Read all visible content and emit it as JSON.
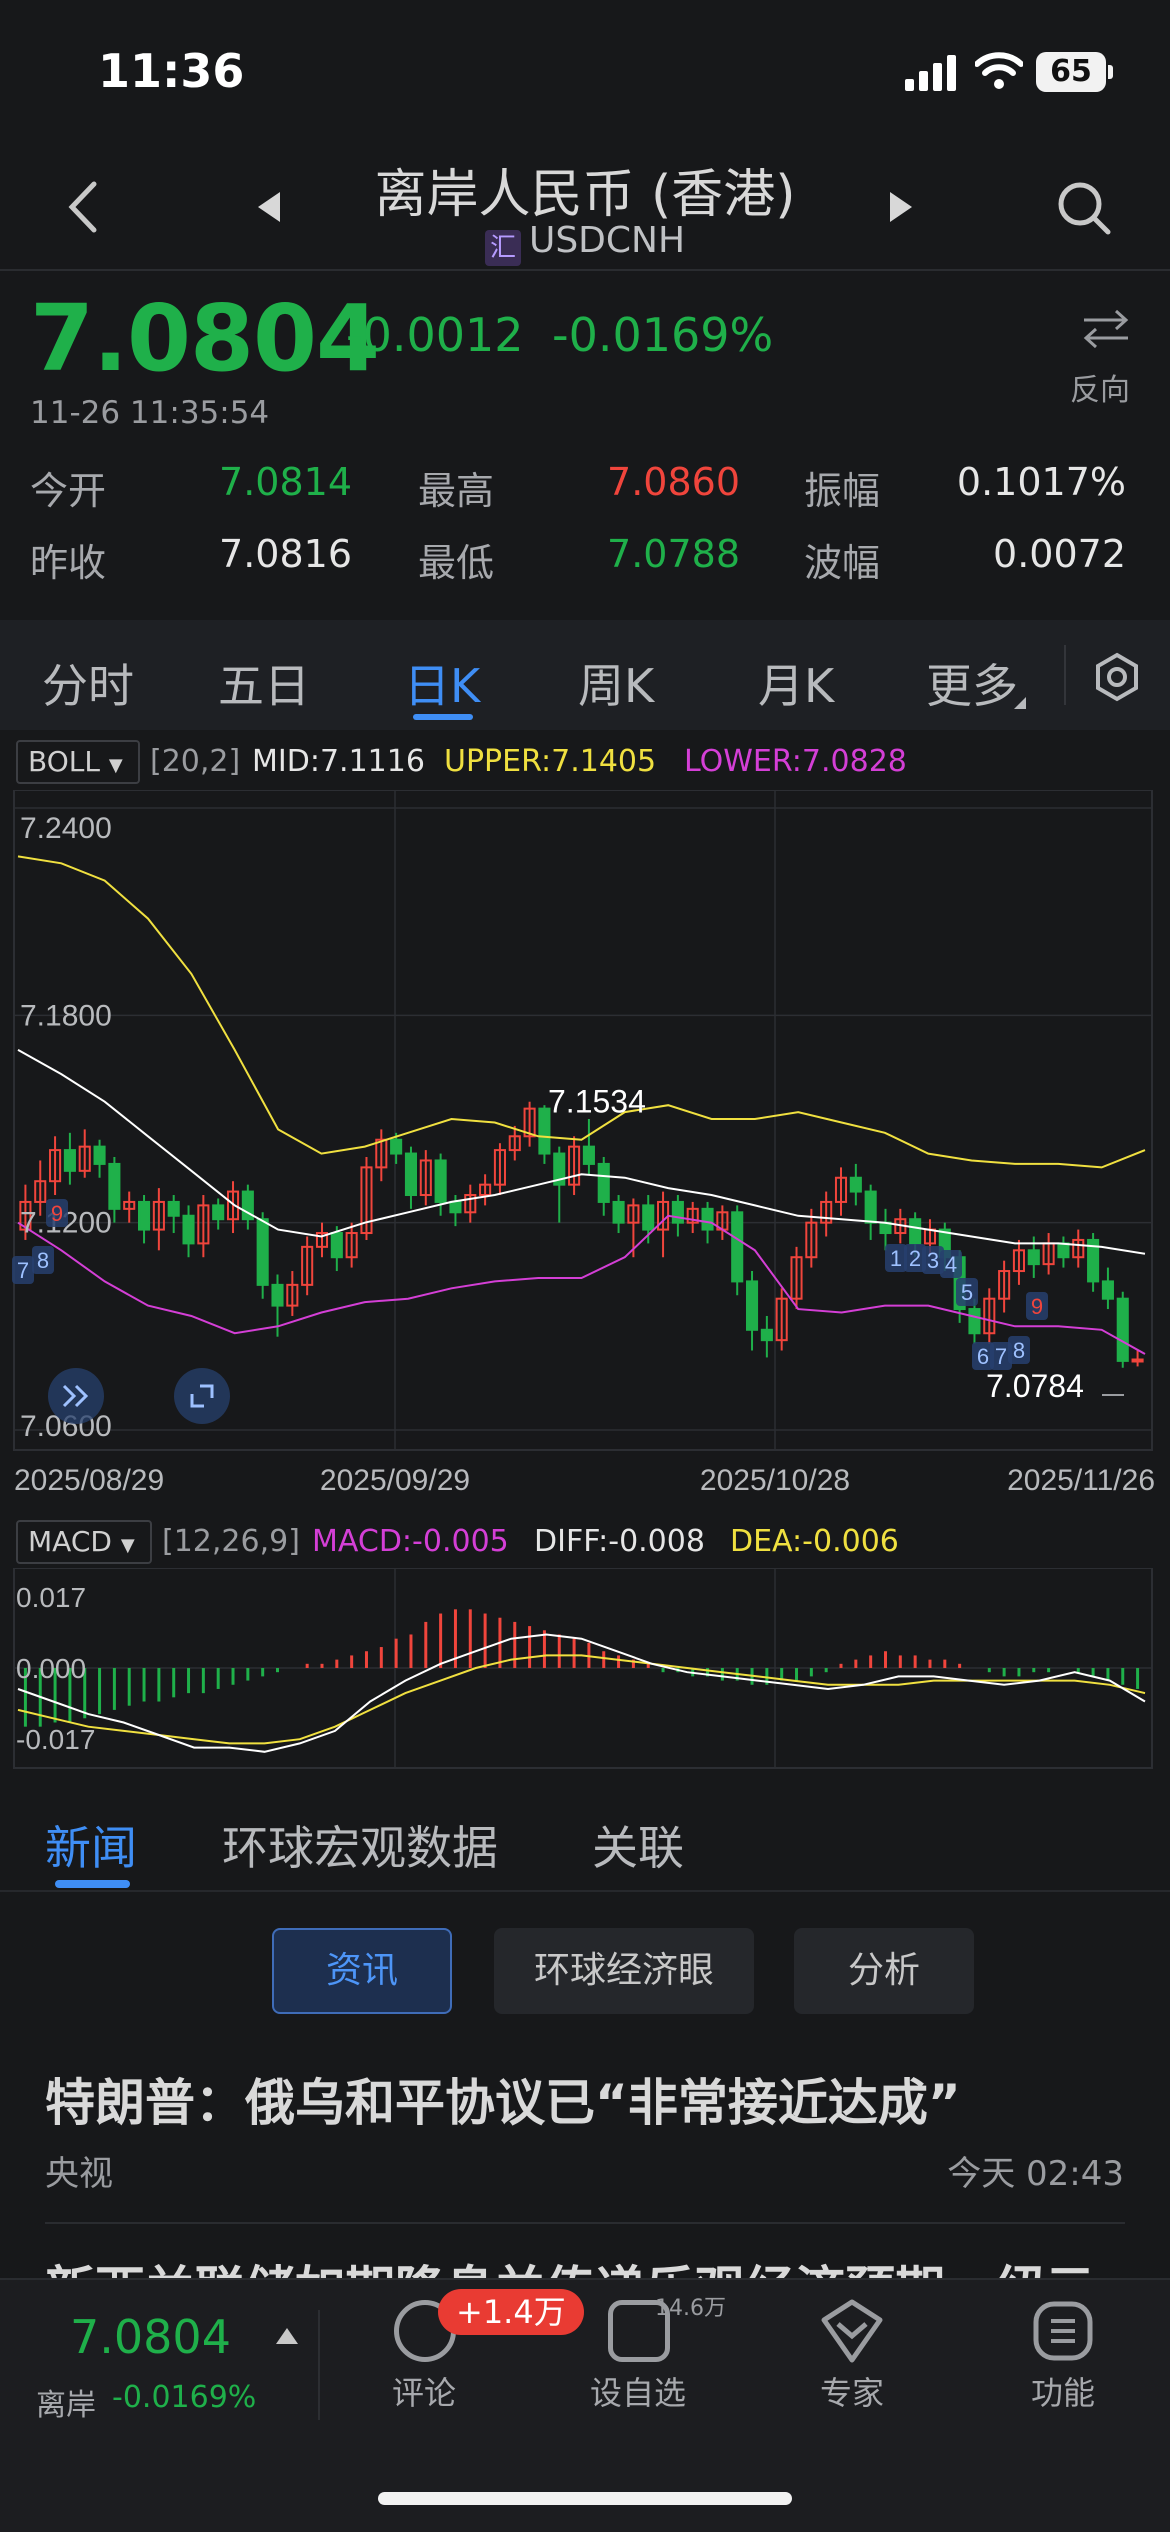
{
  "status_bar": {
    "time": "11:36",
    "battery": "65"
  },
  "header": {
    "title": "离岸人民币 (香港)",
    "hui_icon_text": "汇",
    "symbol": "USDCNH"
  },
  "quote": {
    "price": "7.0804",
    "change": "-0.0012",
    "change_pct": "-0.0169%",
    "timestamp": "11-26 11:35:54",
    "reverse_label": "反向",
    "stats": [
      {
        "label": "今开",
        "value": "7.0814",
        "color": "green"
      },
      {
        "label": "最高",
        "value": "7.0860",
        "color": "red"
      },
      {
        "label": "振幅",
        "value": "0.1017%",
        "color": "white"
      },
      {
        "label": "昨收",
        "value": "7.0816",
        "color": "white"
      },
      {
        "label": "最低",
        "value": "7.0788",
        "color": "green"
      },
      {
        "label": "波幅",
        "value": "0.0072",
        "color": "white"
      }
    ]
  },
  "period_tabs": [
    "分时",
    "五日",
    "日K",
    "周K",
    "月K",
    "更多"
  ],
  "active_tab": "日K",
  "boll": {
    "name": "BOLL",
    "params": "[20,2]",
    "mid": "MID:7.1116",
    "upper": "UPPER:7.1405",
    "lower": "LOWER:7.0828"
  },
  "macd": {
    "name": "MACD",
    "params": "[12,26,9]",
    "macd": "MACD:-0.005",
    "diff": "DIFF:-0.008",
    "dea": "DEA:-0.006"
  },
  "chart_data": [
    {
      "type": "candlestick",
      "y_ticks": [
        "7.2400",
        "7.1800",
        "7.1200",
        "7.0600"
      ],
      "ylim": [
        7.06,
        7.24
      ],
      "x_ticks": [
        "2025/08/29",
        "2025/09/29",
        "2025/10/28",
        "2025/11/26"
      ],
      "annotations": {
        "high": "7.1534",
        "low": "7.0784"
      },
      "counters": [
        "7",
        "8",
        "9",
        "1",
        "2",
        "3",
        "4",
        "5",
        "6",
        "7",
        "8",
        "9"
      ],
      "candles": [
        [
          7.118,
          7.126,
          7.131,
          7.115
        ],
        [
          7.126,
          7.132,
          7.138,
          7.122
        ],
        [
          7.132,
          7.141,
          7.145,
          7.128
        ],
        [
          7.141,
          7.135,
          7.146,
          7.131
        ],
        [
          7.135,
          7.142,
          7.147,
          7.133
        ],
        [
          7.142,
          7.137,
          7.144,
          7.133
        ],
        [
          7.137,
          7.124,
          7.139,
          7.12
        ],
        [
          7.124,
          7.126,
          7.129,
          7.12
        ],
        [
          7.126,
          7.118,
          7.128,
          7.114
        ],
        [
          7.118,
          7.126,
          7.13,
          7.112
        ],
        [
          7.126,
          7.122,
          7.128,
          7.117
        ],
        [
          7.122,
          7.114,
          7.125,
          7.11
        ],
        [
          7.114,
          7.125,
          7.128,
          7.11
        ],
        [
          7.125,
          7.121,
          7.127,
          7.118
        ],
        [
          7.121,
          7.129,
          7.132,
          7.117
        ],
        [
          7.129,
          7.121,
          7.131,
          7.118
        ],
        [
          7.121,
          7.102,
          7.123,
          7.098
        ],
        [
          7.102,
          7.096,
          7.105,
          7.087
        ],
        [
          7.096,
          7.102,
          7.106,
          7.093
        ],
        [
          7.102,
          7.113,
          7.116,
          7.099
        ],
        [
          7.113,
          7.117,
          7.12,
          7.11
        ],
        [
          7.117,
          7.11,
          7.119,
          7.106
        ],
        [
          7.11,
          7.117,
          7.12,
          7.107
        ],
        [
          7.117,
          7.136,
          7.139,
          7.115
        ],
        [
          7.136,
          7.144,
          7.147,
          7.132
        ],
        [
          7.144,
          7.14,
          7.146,
          7.137
        ],
        [
          7.14,
          7.128,
          7.142,
          7.124
        ],
        [
          7.128,
          7.138,
          7.141,
          7.125
        ],
        [
          7.138,
          7.126,
          7.14,
          7.122
        ],
        [
          7.126,
          7.123,
          7.128,
          7.119
        ],
        [
          7.123,
          7.128,
          7.131,
          7.12
        ],
        [
          7.128,
          7.131,
          7.134,
          7.125
        ],
        [
          7.131,
          7.141,
          7.143,
          7.128
        ],
        [
          7.141,
          7.145,
          7.148,
          7.138
        ],
        [
          7.145,
          7.153,
          7.155,
          7.142
        ],
        [
          7.153,
          7.14,
          7.154,
          7.137
        ],
        [
          7.14,
          7.131,
          7.142,
          7.12
        ],
        [
          7.131,
          7.142,
          7.145,
          7.128
        ],
        [
          7.142,
          7.137,
          7.15,
          7.134
        ],
        [
          7.137,
          7.126,
          7.139,
          7.122
        ],
        [
          7.126,
          7.12,
          7.128,
          7.117
        ],
        [
          7.12,
          7.125,
          7.127,
          7.11
        ],
        [
          7.125,
          7.118,
          7.128,
          7.114
        ],
        [
          7.118,
          7.126,
          7.129,
          7.11
        ],
        [
          7.126,
          7.12,
          7.128,
          7.116
        ],
        [
          7.12,
          7.124,
          7.126,
          7.117
        ],
        [
          7.124,
          7.118,
          7.126,
          7.114
        ],
        [
          7.118,
          7.123,
          7.125,
          7.115
        ],
        [
          7.123,
          7.103,
          7.125,
          7.099
        ],
        [
          7.103,
          7.089,
          7.106,
          7.083
        ],
        [
          7.089,
          7.086,
          7.093,
          7.081
        ],
        [
          7.086,
          7.098,
          7.101,
          7.083
        ],
        [
          7.098,
          7.11,
          7.113,
          7.095
        ],
        [
          7.11,
          7.12,
          7.124,
          7.107
        ],
        [
          7.12,
          7.126,
          7.129,
          7.116
        ],
        [
          7.126,
          7.133,
          7.136,
          7.122
        ],
        [
          7.133,
          7.129,
          7.137,
          7.125
        ],
        [
          7.129,
          7.12,
          7.131,
          7.115
        ],
        [
          7.12,
          7.117,
          7.124,
          7.112
        ],
        [
          7.117,
          7.121,
          7.124,
          7.114
        ],
        [
          7.121,
          7.114,
          7.123,
          7.11
        ],
        [
          7.114,
          7.118,
          7.121,
          7.111
        ],
        [
          7.118,
          7.11,
          7.12,
          7.106
        ],
        [
          7.11,
          7.095,
          7.112,
          7.091
        ],
        [
          7.095,
          7.088,
          7.098,
          7.085
        ],
        [
          7.088,
          7.098,
          7.101,
          7.085
        ],
        [
          7.098,
          7.106,
          7.109,
          7.094
        ],
        [
          7.106,
          7.112,
          7.115,
          7.102
        ],
        [
          7.112,
          7.108,
          7.116,
          7.104
        ],
        [
          7.108,
          7.114,
          7.117,
          7.105
        ],
        [
          7.114,
          7.11,
          7.116,
          7.107
        ],
        [
          7.11,
          7.115,
          7.118,
          7.107
        ],
        [
          7.115,
          7.103,
          7.117,
          7.1
        ],
        [
          7.103,
          7.098,
          7.107,
          7.095
        ],
        [
          7.098,
          7.08,
          7.1,
          7.078
        ],
        [
          7.08,
          7.0804,
          7.083,
          7.0784
        ]
      ],
      "boll_mid": [
        7.17,
        7.163,
        7.155,
        7.145,
        7.135,
        7.125,
        7.118,
        7.116,
        7.12,
        7.123,
        7.126,
        7.128,
        7.131,
        7.134,
        7.133,
        7.13,
        7.128,
        7.125,
        7.122,
        7.121,
        7.12,
        7.118,
        7.116,
        7.114,
        7.114,
        7.113,
        7.111
      ],
      "boll_upper": [
        7.226,
        7.224,
        7.219,
        7.208,
        7.192,
        7.17,
        7.147,
        7.14,
        7.142,
        7.146,
        7.15,
        7.149,
        7.145,
        7.144,
        7.152,
        7.154,
        7.15,
        7.15,
        7.152,
        7.149,
        7.146,
        7.14,
        7.138,
        7.137,
        7.137,
        7.136,
        7.141
      ],
      "boll_lower": [
        7.12,
        7.112,
        7.103,
        7.096,
        7.093,
        7.088,
        7.09,
        7.094,
        7.097,
        7.098,
        7.101,
        7.103,
        7.104,
        7.104,
        7.11,
        7.122,
        7.12,
        7.112,
        7.095,
        7.094,
        7.096,
        7.096,
        7.093,
        7.09,
        7.09,
        7.089,
        7.082
      ]
    },
    {
      "type": "macd",
      "y_ticks": [
        "0.017",
        "0.000",
        "-0.017"
      ],
      "ylim": [
        -0.021,
        0.021
      ],
      "histogram": [
        -0.014,
        -0.014,
        -0.013,
        -0.013,
        -0.012,
        -0.011,
        -0.01,
        -0.009,
        -0.008,
        -0.008,
        -0.007,
        -0.006,
        -0.006,
        -0.005,
        -0.004,
        -0.003,
        -0.002,
        -0.001,
        0.0,
        0.001,
        0.001,
        0.002,
        0.003,
        0.004,
        0.005,
        0.007,
        0.008,
        0.011,
        0.013,
        0.014,
        0.014,
        0.013,
        0.012,
        0.011,
        0.01,
        0.009,
        0.008,
        0.007,
        0.006,
        0.004,
        0.003,
        0.002,
        0.001,
        -0.001,
        -0.001,
        -0.002,
        -0.002,
        -0.003,
        -0.003,
        -0.004,
        -0.004,
        -0.003,
        -0.003,
        -0.002,
        -0.001,
        0.001,
        0.002,
        0.003,
        0.004,
        0.003,
        0.003,
        0.002,
        0.002,
        0.001,
        0.0,
        -0.001,
        -0.002,
        -0.002,
        -0.001,
        -0.001,
        0.0,
        -0.001,
        -0.002,
        -0.003,
        -0.004,
        -0.005
      ],
      "diff": [
        -0.005,
        -0.008,
        -0.011,
        -0.013,
        -0.016,
        -0.019,
        -0.019,
        -0.02,
        -0.018,
        -0.015,
        -0.008,
        -0.003,
        0.001,
        0.004,
        0.007,
        0.008,
        0.007,
        0.004,
        0.001,
        -0.001,
        -0.002,
        -0.003,
        -0.004,
        -0.005,
        -0.004,
        -0.002,
        -0.002,
        -0.003,
        -0.004,
        -0.003,
        -0.001,
        -0.003,
        -0.008
      ],
      "dea": [
        -0.01,
        -0.012,
        -0.014,
        -0.015,
        -0.016,
        -0.017,
        -0.018,
        -0.018,
        -0.017,
        -0.014,
        -0.01,
        -0.006,
        -0.003,
        0.0,
        0.002,
        0.003,
        0.003,
        0.002,
        0.001,
        0.0,
        -0.001,
        -0.002,
        -0.003,
        -0.004,
        -0.004,
        -0.004,
        -0.003,
        -0.003,
        -0.003,
        -0.003,
        -0.003,
        -0.004,
        -0.006
      ]
    }
  ],
  "news": {
    "tabs": [
      "新闻",
      "环球宏观数据",
      "关联"
    ],
    "chips": [
      "资讯",
      "环球经济眼",
      "分析"
    ],
    "items": [
      {
        "title": "特朗普：俄乌和平协议已“非常接近达成”",
        "source": "央视",
        "time": "今天 02:43"
      },
      {
        "title": "新西兰联储如期降息并传递乐观经济预期，纽元"
      }
    ]
  },
  "bottom_bar": {
    "price": "7.0804",
    "label": "离岸",
    "change_pct": "-0.0169%",
    "items": [
      "评论",
      "设自选",
      "专家",
      "功能"
    ],
    "comment_badge": "+1.4万",
    "watch_count": "14.6万"
  },
  "colors": {
    "up": "#f0453c",
    "down": "#1fb04a",
    "accent": "#3f8ef5",
    "upper": "#f0e040",
    "lower": "#d43fd6"
  }
}
